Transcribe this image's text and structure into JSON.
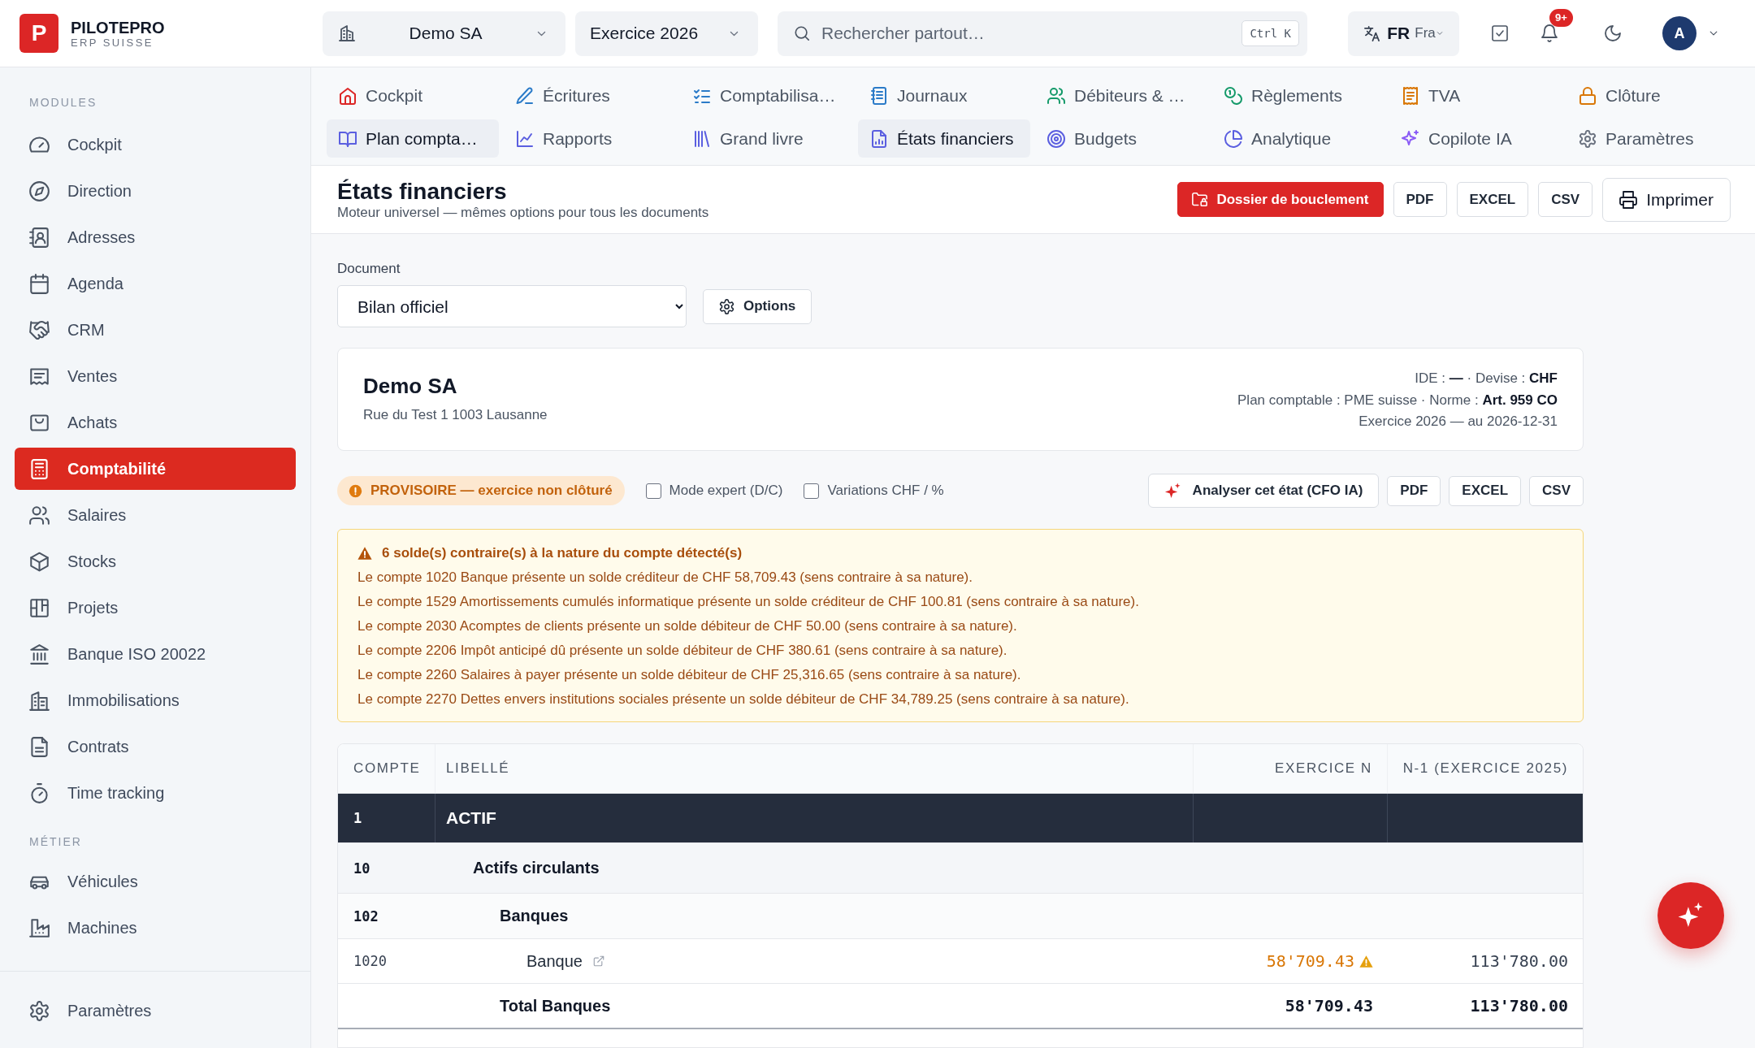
{
  "topbar": {
    "logo_letter": "P",
    "brand": "PILOTEPRO",
    "tagline": "ERP SUISSE",
    "company": "Demo SA",
    "fiscal_year": "Exercice 2026",
    "search": {
      "placeholder": "Rechercher partout…",
      "shortcut": "Ctrl K"
    },
    "language": {
      "code": "FR",
      "name": "Fra"
    },
    "notifications": "9+",
    "avatar": "A"
  },
  "sidebar": {
    "sections": [
      {
        "label": "MODULES",
        "items": [
          {
            "label": "Cockpit",
            "selected": false
          },
          {
            "label": "Direction",
            "selected": false
          },
          {
            "label": "Adresses",
            "selected": false
          },
          {
            "label": "Agenda",
            "selected": false
          },
          {
            "label": "CRM",
            "selected": false
          },
          {
            "label": "Ventes",
            "selected": false
          },
          {
            "label": "Achats",
            "selected": false
          },
          {
            "label": "Comptabilité",
            "selected": true
          },
          {
            "label": "Salaires",
            "selected": false
          },
          {
            "label": "Stocks",
            "selected": false
          },
          {
            "label": "Projets",
            "selected": false
          },
          {
            "label": "Banque ISO 20022",
            "selected": false
          },
          {
            "label": "Immobilisations",
            "selected": false
          },
          {
            "label": "Contrats",
            "selected": false
          },
          {
            "label": "Time tracking",
            "selected": false
          }
        ]
      },
      {
        "label": "MÉTIER",
        "items": [
          {
            "label": "Véhicules",
            "selected": false
          },
          {
            "label": "Machines",
            "selected": false
          }
        ]
      }
    ],
    "footer": {
      "label": "Paramètres",
      "selected": false
    }
  },
  "tabs": [
    {
      "label": "Cockpit",
      "color": "#dc2626",
      "selected": false
    },
    {
      "label": "Écritures",
      "color": "#2b7bc8",
      "selected": false
    },
    {
      "label": "Comptabilisa…",
      "color": "#2b7bc8",
      "selected": false
    },
    {
      "label": "Journaux",
      "color": "#2b7bc8",
      "selected": false
    },
    {
      "label": "Débiteurs & …",
      "color": "#159a6a",
      "selected": false
    },
    {
      "label": "Règlements",
      "color": "#159a6a",
      "selected": false
    },
    {
      "label": "TVA",
      "color": "#d97706",
      "selected": false
    },
    {
      "label": "Clôture",
      "color": "#d97706",
      "selected": false
    },
    {
      "label": "Plan compta…",
      "color": "#5b5fe0",
      "selected": true
    },
    {
      "label": "Rapports",
      "color": "#5b5fe0",
      "selected": false
    },
    {
      "label": "Grand livre",
      "color": "#5b5fe0",
      "selected": false
    },
    {
      "label": "États financiers",
      "color": "#5b5fe0",
      "selected": true
    },
    {
      "label": "Budgets",
      "color": "#5b5fe0",
      "selected": false
    },
    {
      "label": "Analytique",
      "color": "#5b5fe0",
      "selected": false
    },
    {
      "label": "Copilote IA",
      "color": "#8b5cf6",
      "selected": false
    },
    {
      "label": "Paramètres",
      "color": "#6b7280",
      "selected": false
    }
  ],
  "page": {
    "title": "États financiers",
    "subtitle": "Moteur universel — mêmes options pour tous les documents",
    "actions": [
      {
        "label": "Dossier de bouclement",
        "kind": "primary"
      },
      {
        "label": "PDF",
        "kind": "plain"
      },
      {
        "label": "EXCEL",
        "kind": "plain"
      },
      {
        "label": "CSV",
        "kind": "plain"
      },
      {
        "label": "Imprimer",
        "kind": "print"
      }
    ]
  },
  "document": {
    "label": "Document",
    "value": "Bilan officiel",
    "options_button": "Options"
  },
  "company_card": {
    "name": "Demo SA",
    "address": "Rue du Test 1 1003 Lausanne",
    "details": [
      "IDE : **—** · Devise : **CHF**",
      "Plan comptable : PME suisse · Norme : **Art. 959 CO**",
      "Exercice 2026 — au 2026-12-31"
    ]
  },
  "toolbar": {
    "status": "PROVISOIRE — exercice non clôturé",
    "toggles": [
      {
        "label": "Mode expert (D/C)",
        "checked": false
      },
      {
        "label": "Variations CHF / %",
        "checked": false
      }
    ],
    "actions": [
      {
        "label": "Analyser cet état (CFO IA)",
        "kind": "ai"
      },
      {
        "label": "PDF",
        "kind": "plain"
      },
      {
        "label": "EXCEL",
        "kind": "plain"
      },
      {
        "label": "CSV",
        "kind": "plain"
      }
    ]
  },
  "alert": {
    "title": "6 solde(s) contraire(s) à la nature du compte détecté(s)",
    "lines": [
      "Le compte 1020 Banque présente un solde créditeur de CHF 58,709.43 (sens contraire à sa nature).",
      "Le compte 1529 Amortissements cumulés informatique présente un solde créditeur de CHF 100.81 (sens contraire à sa nature).",
      "Le compte 2030 Acomptes de clients présente un solde débiteur de CHF 50.00 (sens contraire à sa nature).",
      "Le compte 2206 Impôt anticipé dû présente un solde débiteur de CHF 380.61 (sens contraire à sa nature).",
      "Le compte 2260 Salaires à payer présente un solde débiteur de CHF 25,316.65 (sens contraire à sa nature).",
      "Le compte 2270 Dettes envers institutions sociales présente un solde débiteur de CHF 34,789.25 (sens contraire à sa nature)."
    ]
  },
  "table": {
    "columns": [
      "COMPTE",
      "LIBELLÉ",
      "EXERCICE N",
      "N-1 (EXERCICE 2025)"
    ],
    "rows": [
      {
        "kind": "class",
        "account": "1",
        "label": "ACTIF",
        "children": [
          {
            "kind": "group",
            "account": "10",
            "label": "Actifs circulants",
            "children": [
              {
                "kind": "subgroup",
                "account": "102",
                "label": "Banques",
                "children": [
                  {
                    "kind": "account",
                    "account": "1020",
                    "label": "Banque",
                    "current": "58'709.43",
                    "previous": "113'780.00",
                    "contrary": true
                  }
                ],
                "total": {
                  "label": "Total Banques",
                  "current": "58'709.43",
                  "previous": "113'780.00"
                }
              }
            ]
          }
        ]
      }
    ]
  }
}
